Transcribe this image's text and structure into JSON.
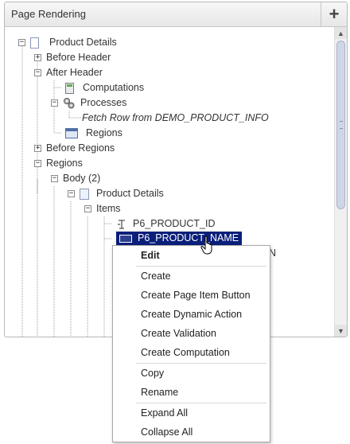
{
  "panel": {
    "title": "Page Rendering",
    "add_icon": "plus-icon"
  },
  "tree": {
    "root": "Product Details",
    "before_header": "Before Header",
    "after_header": "After Header",
    "computations": "Computations",
    "processes": "Processes",
    "fetch_row": "Fetch Row from DEMO_PRODUCT_INFO",
    "regions_sub": "Regions",
    "before_regions": "Before Regions",
    "regions": "Regions",
    "body": "Body (2)",
    "region_product_details": "Product Details",
    "items": "Items",
    "item1": "P6_PRODUCT_ID",
    "item2": "P6_PRODUCT_NAME",
    "item3_partial": "N"
  },
  "context_menu": {
    "edit": "Edit",
    "create": "Create",
    "create_page_item_button": "Create Page Item Button",
    "create_dynamic_action": "Create Dynamic Action",
    "create_validation": "Create Validation",
    "create_computation": "Create Computation",
    "copy": "Copy",
    "rename": "Rename",
    "expand_all": "Expand All",
    "collapse_all": "Collapse All"
  },
  "colors": {
    "selection": "#0a1f7a",
    "header_bg": "#eeeeee"
  }
}
